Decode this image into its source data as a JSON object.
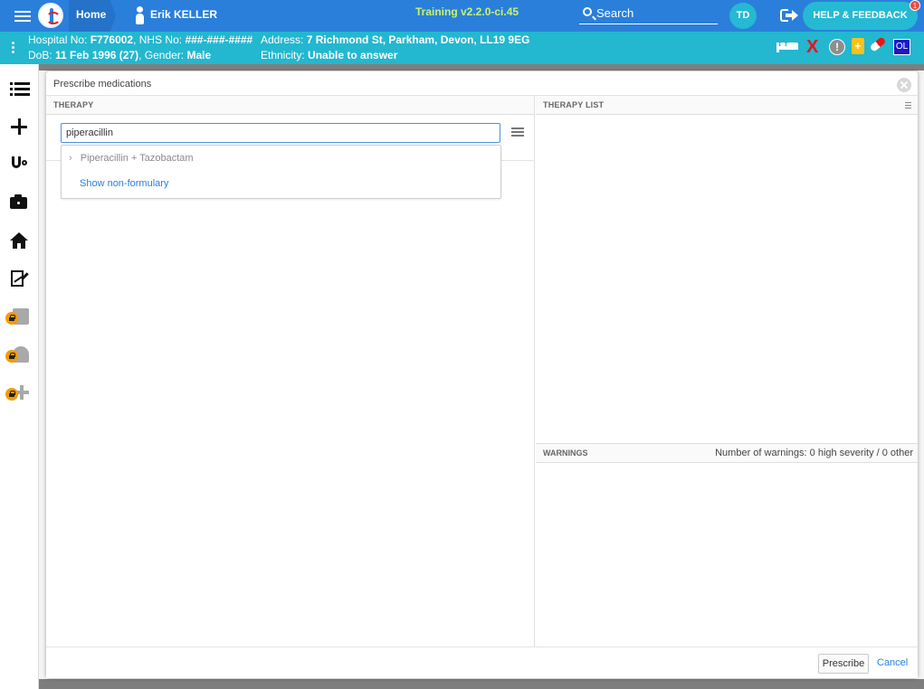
{
  "header": {
    "home_label": "Home",
    "patient_name": "Erik KELLER",
    "version": "Training v2.2.0-ci.45",
    "search_label": "Search",
    "user_initials": "TD",
    "help_label": "HELP & FEEDBACK",
    "help_badge": "1"
  },
  "patient": {
    "hospital_no_label": "Hospital No:",
    "hospital_no": "F776002",
    "nhs_no_label": "NHS No:",
    "nhs_no": "###-###-####",
    "dob_label": "DoB:",
    "dob": "11 Feb 1996 (27)",
    "gender_label": "Gender:",
    "gender": "Male",
    "address_label": "Address:",
    "address": "7 Richmond St, Parkham, Devon, LL19 9EG",
    "ethnicity_label": "Ethnicity:",
    "ethnicity": "Unable to answer",
    "status_icons": {
      "x_mark": "X",
      "alert": "!",
      "clipboard": "+",
      "ol_badge": "OL"
    }
  },
  "modal": {
    "title": "Prescribe medications",
    "therapy_header": "THERAPY",
    "therapy_list_header": "THERAPY LIST",
    "warnings_header": "WARNINGS",
    "warnings_count": "Number of warnings: 0 high severity / 0 other",
    "search_value": "piperacillin",
    "search_placeholder": "",
    "suggestions": [
      {
        "label": "Piperacillin + Tazobactam"
      }
    ],
    "show_non_formulary": "Show non-formulary",
    "prescribe_label": "Prescribe",
    "cancel_label": "Cancel"
  },
  "colors": {
    "topbar": "#2a7fdb",
    "patient_banner": "#23b7d0",
    "version_text": "#c8f36b",
    "link": "#2a7fdb"
  }
}
